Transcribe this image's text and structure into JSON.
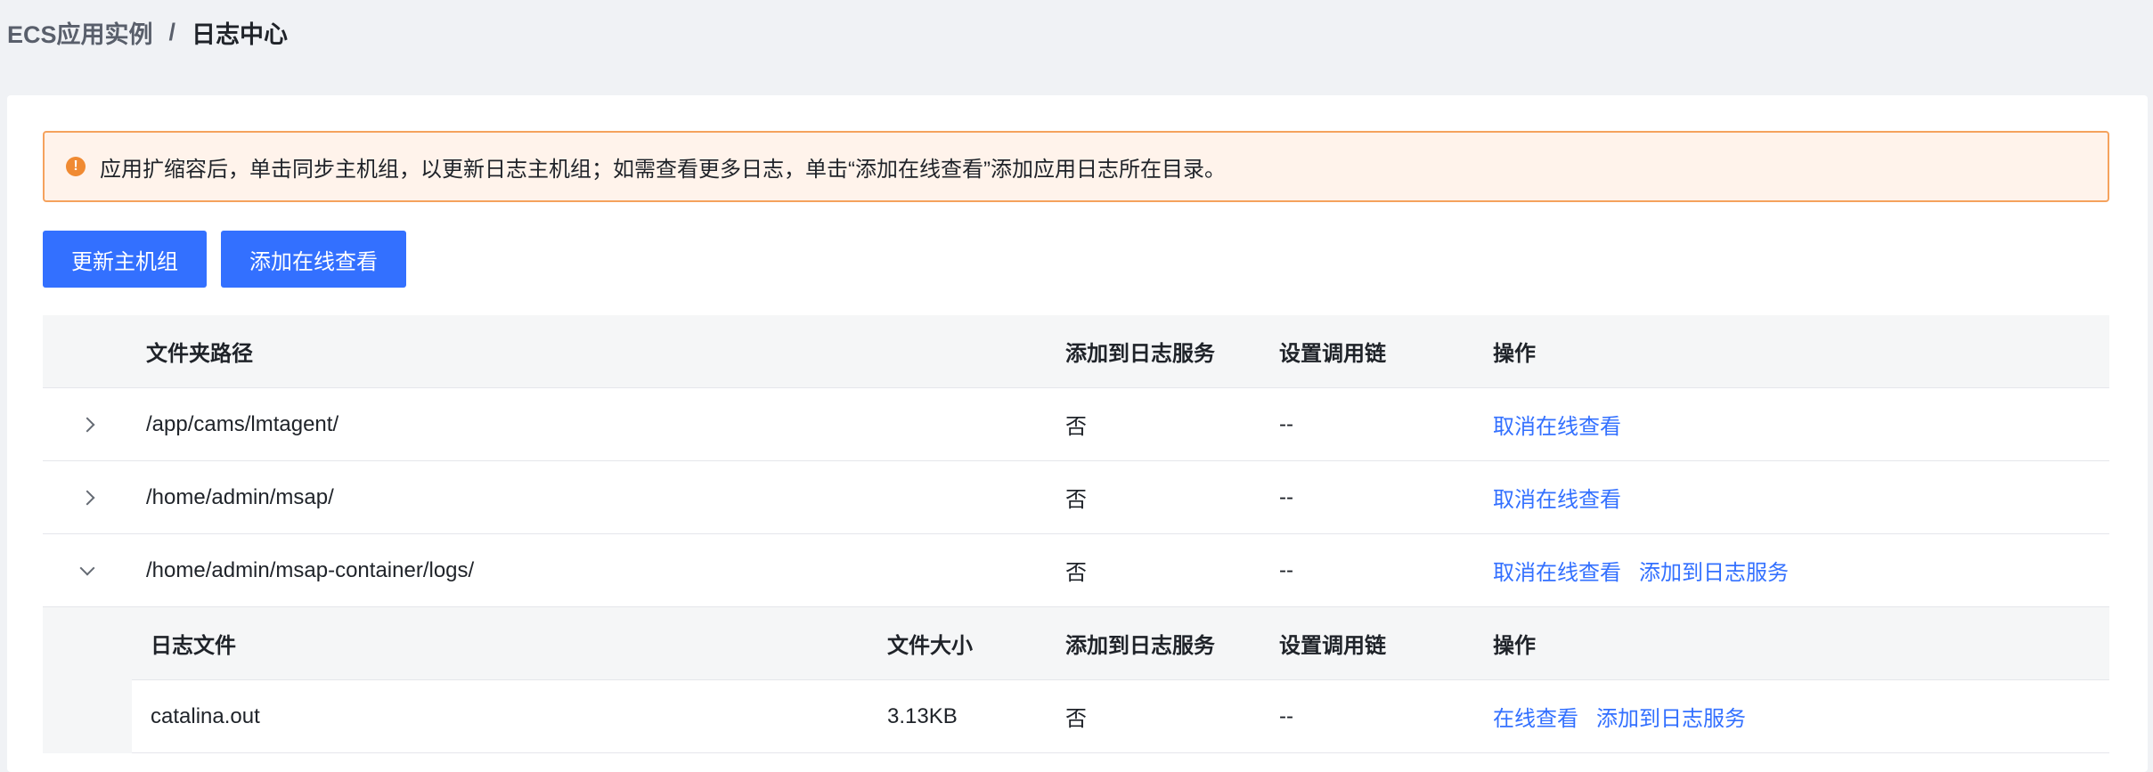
{
  "breadcrumb": {
    "parent": "ECS应用实例",
    "separator": "/",
    "current": "日志中心"
  },
  "alert": {
    "icon": "!",
    "text": "应用扩缩容后，单击同步主机组，以更新日志主机组；如需查看更多日志，单击“添加在线查看”添加应用日志所在目录。"
  },
  "buttons": {
    "update_host_group": "更新主机组",
    "add_online_view": "添加在线查看"
  },
  "table": {
    "columns": {
      "path": "文件夹路径",
      "added_to_log_service": "添加到日志服务",
      "call_chain": "设置调用链",
      "actions": "操作"
    },
    "rows": [
      {
        "path": "/app/cams/lmtagent/",
        "added": "否",
        "chain": "--",
        "actions": [
          "取消在线查看"
        ]
      },
      {
        "path": "/home/admin/msap/",
        "added": "否",
        "chain": "--",
        "actions": [
          "取消在线查看"
        ]
      },
      {
        "path": "/home/admin/msap-container/logs/",
        "added": "否",
        "chain": "--",
        "actions": [
          "取消在线查看",
          "添加到日志服务"
        ]
      }
    ]
  },
  "subtable": {
    "columns": {
      "file": "日志文件",
      "size": "文件大小",
      "added_to_log_service": "添加到日志服务",
      "call_chain": "设置调用链",
      "actions": "操作"
    },
    "rows": [
      {
        "file": "catalina.out",
        "size": "3.13KB",
        "added": "否",
        "chain": "--",
        "actions": [
          "在线查看",
          "添加到日志服务"
        ]
      }
    ]
  },
  "colors": {
    "primary": "#3370ff",
    "warning_border": "#f5a25d",
    "warning_bg": "#fff3eb",
    "warning_icon": "#f08a32"
  }
}
